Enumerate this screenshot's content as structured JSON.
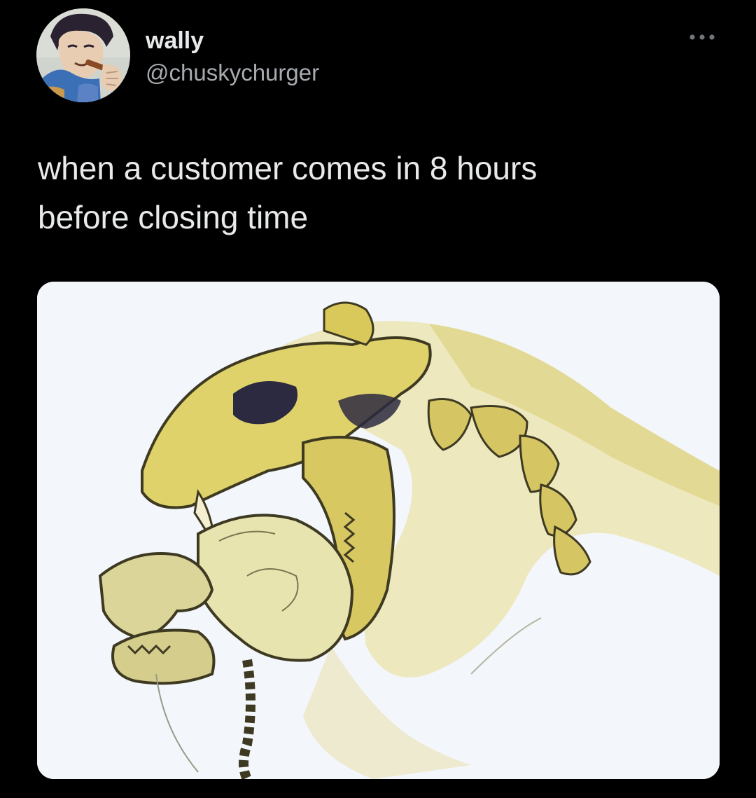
{
  "tweet": {
    "author": {
      "display_name": "wally",
      "handle": "@chuskychurger",
      "avatar_icon": "anime-character-avatar-icon"
    },
    "more_icon": "more-options-icon",
    "text_lines": [
      "when a customer comes in 8 hours",
      "before closing time"
    ],
    "media": {
      "kind": "illustration",
      "subject_icon": "sabertooth-skull-biting-human-skull-illustration"
    }
  },
  "colors": {
    "background": "#000000",
    "text_primary": "#e7e9ea",
    "text_secondary": "#a7abb0",
    "media_background": "#f3f6fb"
  }
}
